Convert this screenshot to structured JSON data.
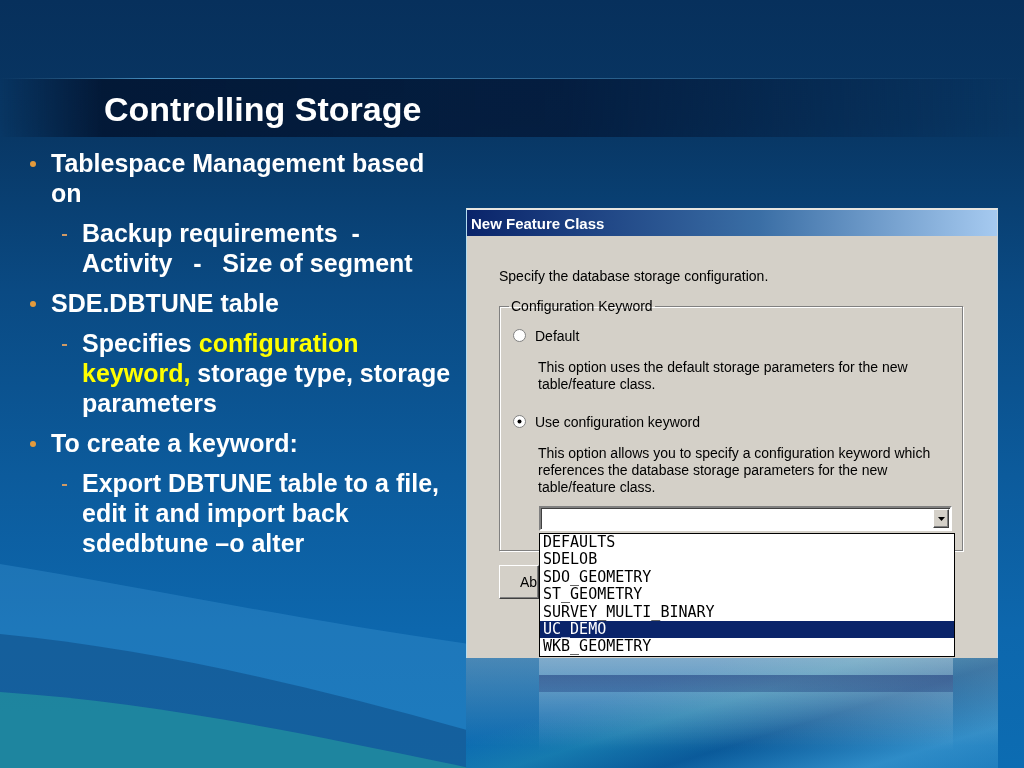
{
  "slide": {
    "title": "Controlling Storage"
  },
  "bullets": [
    {
      "text": "Tablespace Management based on",
      "children": [
        {
          "text": "Backup requirements  -  Activity   -   Size of segment"
        }
      ]
    },
    {
      "text": "SDE.DBTUNE table",
      "children": [
        {
          "runs": [
            {
              "text": "Specifies ",
              "highlight": false
            },
            {
              "text": "configuration keyword,",
              "highlight": true
            },
            {
              "text": " storage type, storage parameters",
              "highlight": false
            }
          ]
        }
      ]
    },
    {
      "text": "To create a keyword:",
      "children": [
        {
          "text": "Export DBTUNE table to a file, edit it and import back sdedbtune –o alter"
        }
      ]
    }
  ],
  "dialog": {
    "title": "New Feature Class",
    "instruction": "Specify the database storage configuration.",
    "group_label": "Configuration Keyword",
    "options": [
      {
        "label": "Default",
        "selected": false,
        "description": "This option uses the default storage parameters for the new table/feature class."
      },
      {
        "label": "Use configuration keyword",
        "selected": true,
        "description": "This option allows you to specify a configuration keyword which references the database storage parameters for the new table/feature class."
      }
    ],
    "keyword_list": {
      "items": [
        {
          "label": "DEFAULTS",
          "selected": false
        },
        {
          "label": "SDELOB",
          "selected": false
        },
        {
          "label": "SDO_GEOMETRY",
          "selected": false
        },
        {
          "label": "ST_GEOMETRY",
          "selected": false
        },
        {
          "label": "SURVEY_MULTI_BINARY",
          "selected": false
        },
        {
          "label": "UC_DEMO",
          "selected": true
        },
        {
          "label": "WKB_GEOMETRY",
          "selected": false
        }
      ]
    },
    "button": {
      "label": "Ab"
    }
  }
}
